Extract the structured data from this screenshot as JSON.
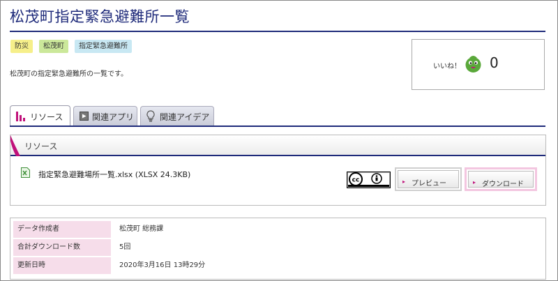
{
  "title": "松茂町指定緊急避難所一覧",
  "tags": [
    "防災",
    "松茂町",
    "指定緊急避難所"
  ],
  "description": "松茂町の指定緊急避難所の一覧です。",
  "like": {
    "label": "いいね！",
    "count": "0"
  },
  "tabs": [
    {
      "label": "リソース",
      "icon": "bar-chart-icon"
    },
    {
      "label": "関連アプリ",
      "icon": "app-window-icon"
    },
    {
      "label": "関連アイデア",
      "icon": "lightbulb-icon"
    }
  ],
  "resource_panel": {
    "title": "リソース",
    "file": {
      "name": "指定緊急避難場所一覧.xlsx (XLSX 24.3KB)",
      "icon": "excel-file-icon"
    },
    "license_icon": "cc-by-icon",
    "preview_label": "プレビュー",
    "download_label": "ダウンロード"
  },
  "info_rows": [
    {
      "key": "データ作成者",
      "value": "松茂町 総務課"
    },
    {
      "key": "合計ダウンロード数",
      "value": "5回"
    },
    {
      "key": "更新日時",
      "value": "2020年3月16日 13時29分"
    }
  ],
  "colors": {
    "accent_navy": "#1e2a7a",
    "accent_pink": "#c0117a",
    "row_key_bg": "#f6ddea"
  }
}
